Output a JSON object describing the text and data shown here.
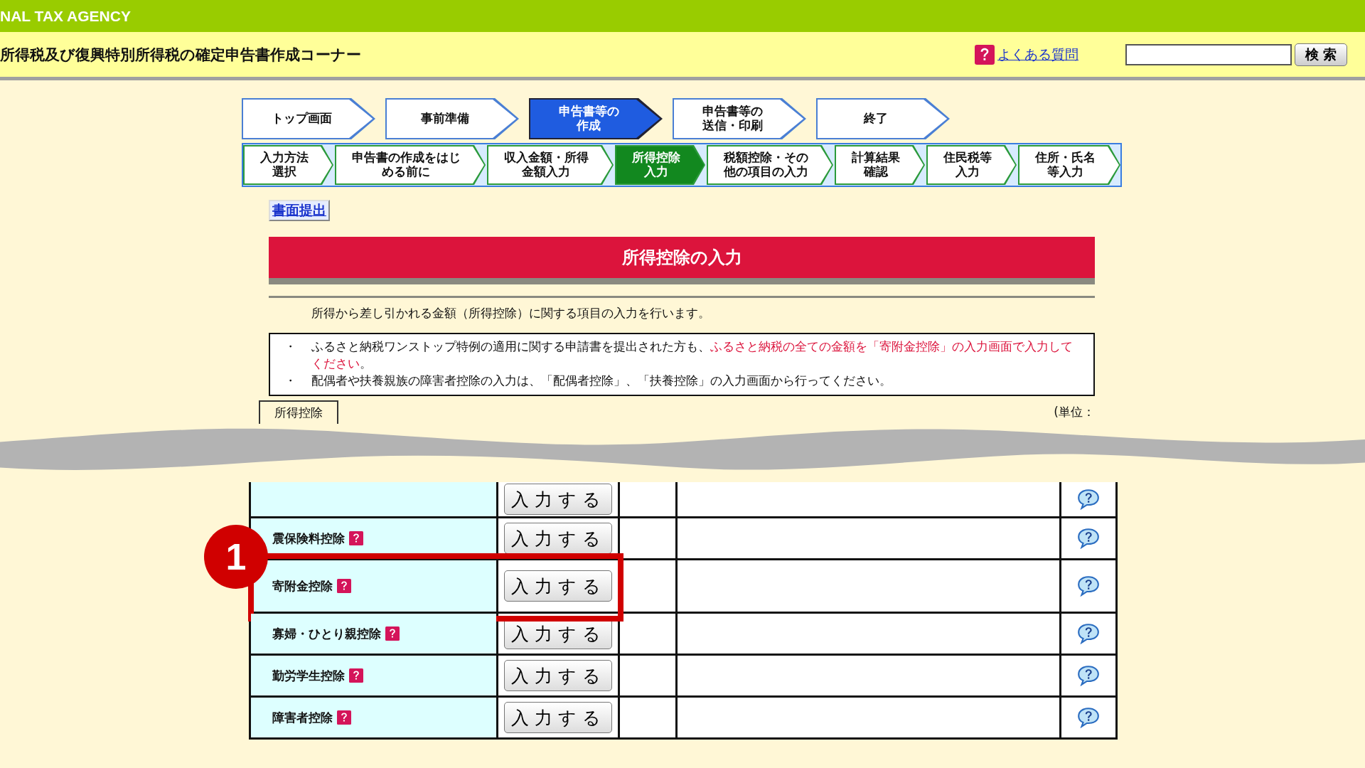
{
  "header": {
    "agency": "NAL TAX AGENCY",
    "title": "所得税及び復興特別所得税の確定申告書作成コーナー",
    "faq_link": "よくある質問",
    "search_button": "検 索"
  },
  "steps": [
    {
      "lines": [
        "トップ画面"
      ],
      "selected": false
    },
    {
      "lines": [
        "事前準備"
      ],
      "selected": false
    },
    {
      "lines": [
        "申告書等の",
        "作成"
      ],
      "selected": true
    },
    {
      "lines": [
        "申告書等の",
        "送信・印刷"
      ],
      "selected": false
    },
    {
      "lines": [
        "終了"
      ],
      "selected": false
    }
  ],
  "substeps": [
    {
      "lines": [
        "入力方法",
        "選択"
      ],
      "selected": false
    },
    {
      "lines": [
        "申告書の作成をはじ",
        "める前に"
      ],
      "selected": false
    },
    {
      "lines": [
        "収入金額・所得",
        "金額入力"
      ],
      "selected": false
    },
    {
      "lines": [
        "所得控除",
        "入力"
      ],
      "selected": true
    },
    {
      "lines": [
        "税額控除・その",
        "他の項目の入力"
      ],
      "selected": false
    },
    {
      "lines": [
        "計算結果",
        "確認"
      ],
      "selected": false
    },
    {
      "lines": [
        "住民税等",
        "入力"
      ],
      "selected": false
    },
    {
      "lines": [
        "住所・氏名",
        "等入力"
      ],
      "selected": false
    }
  ],
  "paper_link": "書面提出",
  "banner": "所得控除の入力",
  "intro": "所得から差し引かれる金額（所得控除）に関する項目の入力を行います。",
  "notices": [
    {
      "bullet": "・",
      "segments": [
        {
          "kind": "normal",
          "text": "ふるさと納税ワンストップ特例の適用に関する申請書を提出された方も、"
        },
        {
          "kind": "red",
          "text": "ふるさと納税の全ての金額を「寄附金控除」の入力画面で入力してください"
        },
        {
          "kind": "normal",
          "text": "。"
        }
      ]
    },
    {
      "bullet": "・",
      "segments": [
        {
          "kind": "normal",
          "text": "配偶者や扶養親族の障害者控除の入力は、「配偶者控除」、「扶養控除」の入力画面から行ってください。"
        }
      ]
    }
  ],
  "table": {
    "tab": "所得控除",
    "unit": "(単位：",
    "rows": [
      {
        "button": "入力する"
      },
      {
        "label": "震保険料控除",
        "button": "入力する"
      },
      {
        "label": "寄附金控除",
        "button": "入力する",
        "annotation": "1"
      },
      {
        "label": "寡婦・ひとり親控除",
        "button": "入力する"
      },
      {
        "label": "勤労学生控除",
        "button": "入力する"
      },
      {
        "label": "障害者控除",
        "button": "入力する"
      }
    ]
  }
}
